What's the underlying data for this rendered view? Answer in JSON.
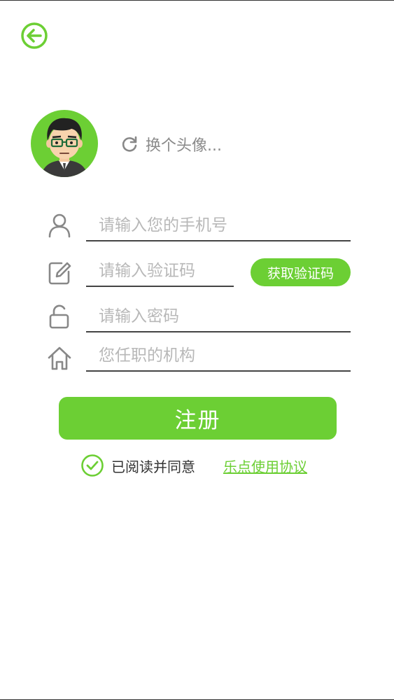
{
  "colors": {
    "accent": "#6ccf34",
    "underline": "#444444",
    "placeholder": "#b8b8b8",
    "icon": "#888888"
  },
  "header": {
    "back_icon": "arrow-left-circle-icon"
  },
  "profile": {
    "change_avatar_label": "换个头像...",
    "refresh_icon": "refresh-icon"
  },
  "form": {
    "phone_placeholder": "请输入您的手机号",
    "code_placeholder": "请输入验证码",
    "get_code_label": "获取验证码",
    "password_placeholder": "请输入密码",
    "org_placeholder": "您任职的机构",
    "icons": {
      "phone": "user-icon",
      "code": "edit-icon",
      "password": "lock-icon",
      "org": "home-icon"
    }
  },
  "actions": {
    "register_label": "注册"
  },
  "agreement": {
    "label": "已阅读并同意",
    "link_label": "乐点使用协议",
    "check_icon": "check-circle-icon"
  }
}
